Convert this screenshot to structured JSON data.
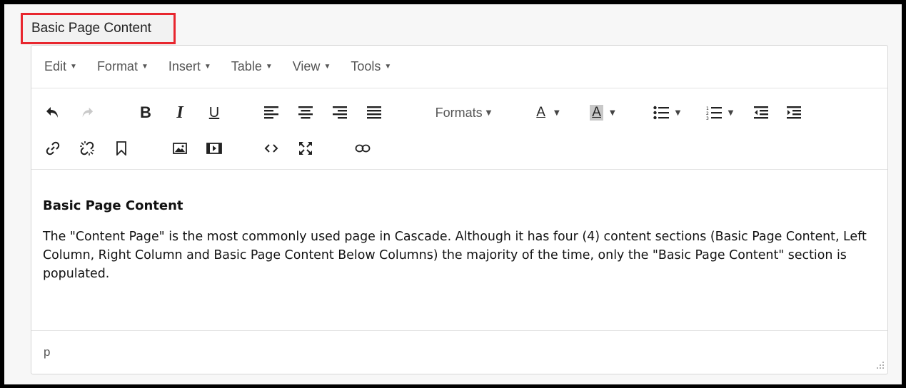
{
  "field": {
    "label": "Basic Page Content"
  },
  "menubar": {
    "items": [
      {
        "label": "Edit"
      },
      {
        "label": "Format"
      },
      {
        "label": "Insert"
      },
      {
        "label": "Table"
      },
      {
        "label": "View"
      },
      {
        "label": "Tools"
      }
    ]
  },
  "toolbar": {
    "bold_label": "B",
    "italic_label": "I",
    "underline_label": "U",
    "formats_label": "Formats",
    "text_color_label": "A",
    "bg_color_label": "A",
    "icons": [
      "undo-icon",
      "redo-icon",
      "bold-icon",
      "italic-icon",
      "underline-icon",
      "align-left-icon",
      "align-center-icon",
      "align-right-icon",
      "align-justify-icon",
      "text-color-icon",
      "background-color-icon",
      "bullet-list-icon",
      "numbered-list-icon",
      "outdent-icon",
      "indent-icon",
      "link-icon",
      "unlink-icon",
      "bookmark-icon",
      "image-icon",
      "media-icon",
      "source-code-icon",
      "fullscreen-icon",
      "link-check-icon"
    ],
    "colors": {
      "highlight_swatch": "#c8c8c8"
    }
  },
  "content": {
    "heading": "Basic Page Content",
    "paragraph": "The \"Content Page\" is the most commonly used page in Cascade.  Although it has four (4) content sections (Basic Page Content, Left Column, Right Column and Basic Page Content Below Columns) the majority of the time, only the \"Basic Page Content\" section is populated."
  },
  "statusbar": {
    "path": "p"
  },
  "colors": {
    "label_border": "#e8262e",
    "frame": "#000000"
  }
}
